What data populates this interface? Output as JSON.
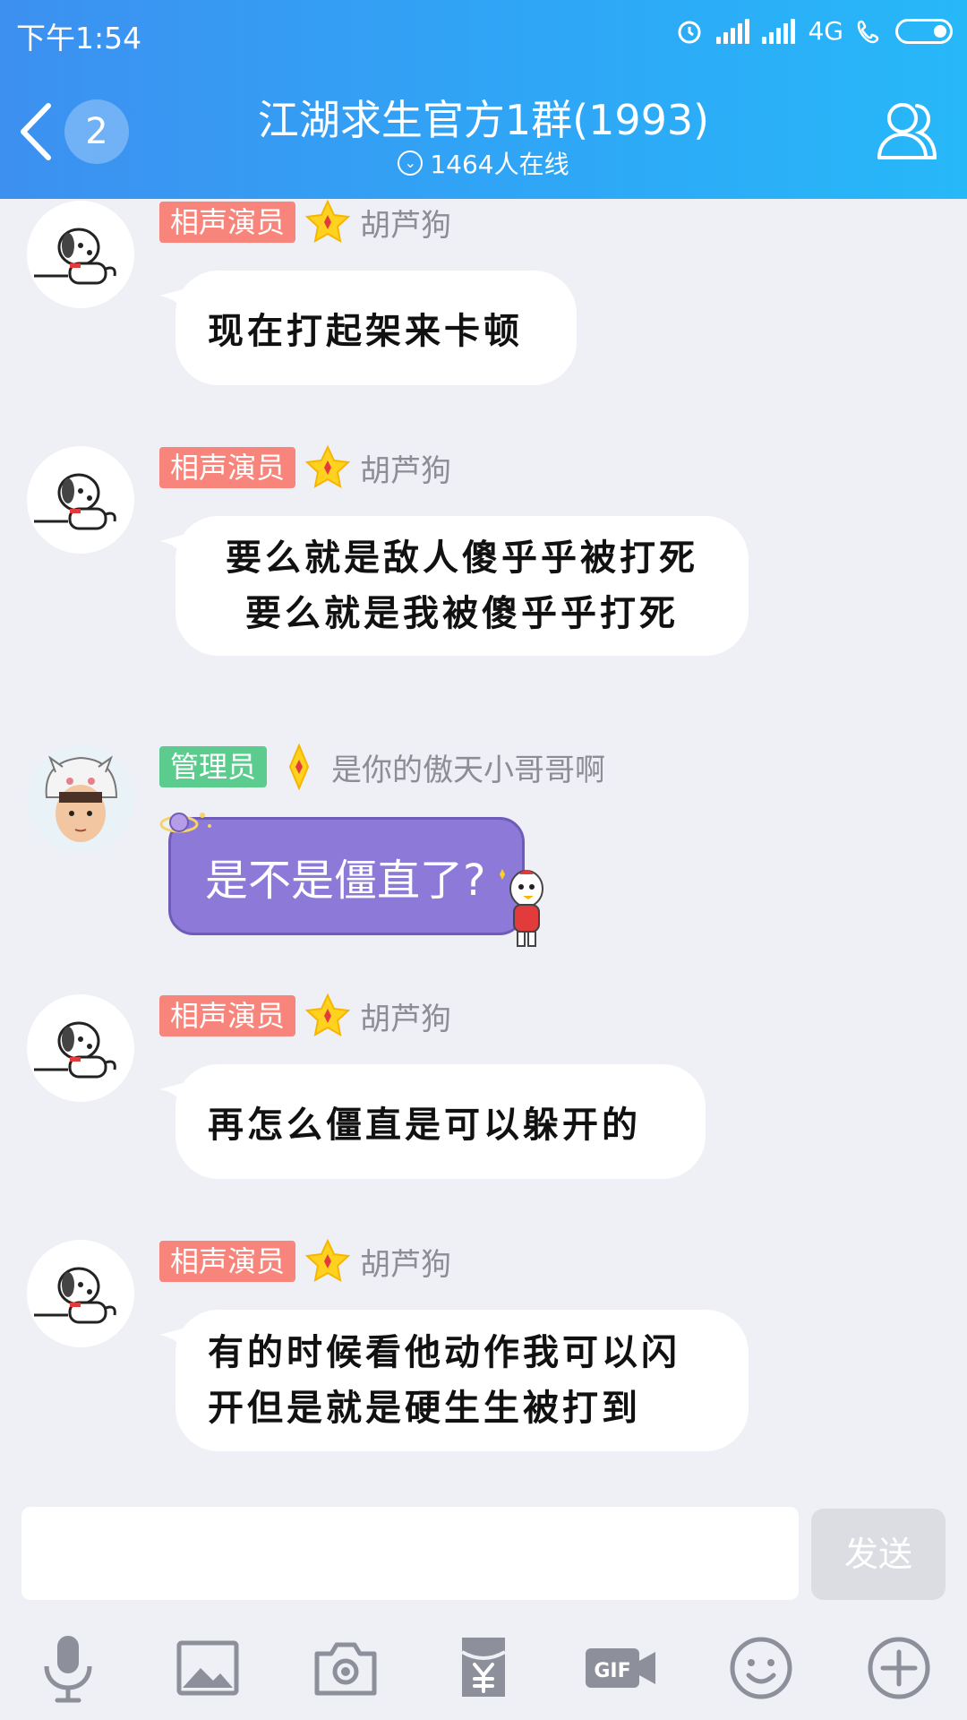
{
  "status": {
    "time": "下午1:54",
    "network": "4G"
  },
  "header": {
    "back_count": "2",
    "title": "江湖求生官方1群(1993)",
    "online": "1464人在线"
  },
  "messages": [
    {
      "role": "相声演员",
      "role_color": "#f8857c",
      "user": "胡芦狗",
      "text": [
        "现在打起架来卡顿"
      ]
    },
    {
      "role": "相声演员",
      "role_color": "#f8857c",
      "user": "胡芦狗",
      "text": [
        "要么就是敌人傻乎乎被打死",
        "要么就是我被傻乎乎打死"
      ]
    },
    {
      "role": "管理员",
      "role_color": "#5ccb8e",
      "user": "是你的傲天小哥哥啊",
      "text": [
        "是不是僵直了?"
      ]
    },
    {
      "role": "相声演员",
      "role_color": "#f8857c",
      "user": "胡芦狗",
      "text": [
        "再怎么僵直是可以躲开的"
      ]
    },
    {
      "role": "相声演员",
      "role_color": "#f8857c",
      "user": "胡芦狗",
      "text": [
        "有的时候看他动作我可以闪",
        "开但是就是硬生生被打到"
      ]
    }
  ],
  "input": {
    "send_label": "发送",
    "value": ""
  },
  "toolbar_icons": [
    "microphone-icon",
    "image-icon",
    "camera-icon",
    "red-packet-icon",
    "gif-icon",
    "emoji-icon",
    "plus-icon"
  ]
}
